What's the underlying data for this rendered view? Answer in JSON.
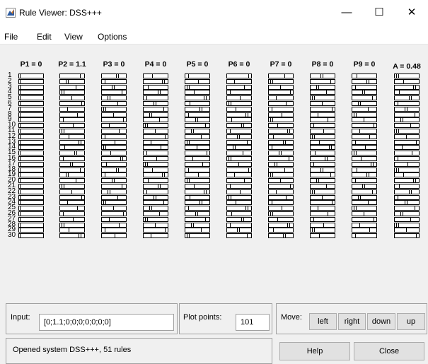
{
  "window": {
    "title": "Rule Viewer: DSS+++",
    "controls": {
      "minimize": "—",
      "maximize": "☐",
      "close": "✕"
    }
  },
  "menu": [
    "File",
    "Edit",
    "View",
    "Options"
  ],
  "columns": [
    "P1 = 0",
    "P2 = 1.1",
    "P3 = 0",
    "P4 = 0",
    "P5 = 0",
    "P6 = 0",
    "P7 = 0",
    "P8 = 0",
    "P9 = 0",
    "A = 0.48"
  ],
  "rules": {
    "visible_numbers": [
      "1",
      "2",
      "3",
      "4",
      "5",
      "6",
      "7",
      "8",
      "9",
      "10",
      "11",
      "12",
      "13",
      "14",
      "15",
      "16",
      "17",
      "18",
      "19",
      "20",
      "21",
      "22",
      "23",
      "24",
      "25",
      "26",
      "27",
      "28",
      "29",
      "30"
    ]
  },
  "input": {
    "label": "Input:",
    "value": "[0;1.1;0;0;0;0;0;0;0]"
  },
  "plot_points": {
    "label": "Plot points:",
    "value": "101"
  },
  "move": {
    "label": "Move:",
    "buttons": [
      "left",
      "right",
      "down",
      "up"
    ]
  },
  "status": "Opened system DSS+++, 51 rules",
  "buttons": {
    "help": "Help",
    "close": "Close"
  },
  "icons": {
    "app": "matlab-icon"
  }
}
